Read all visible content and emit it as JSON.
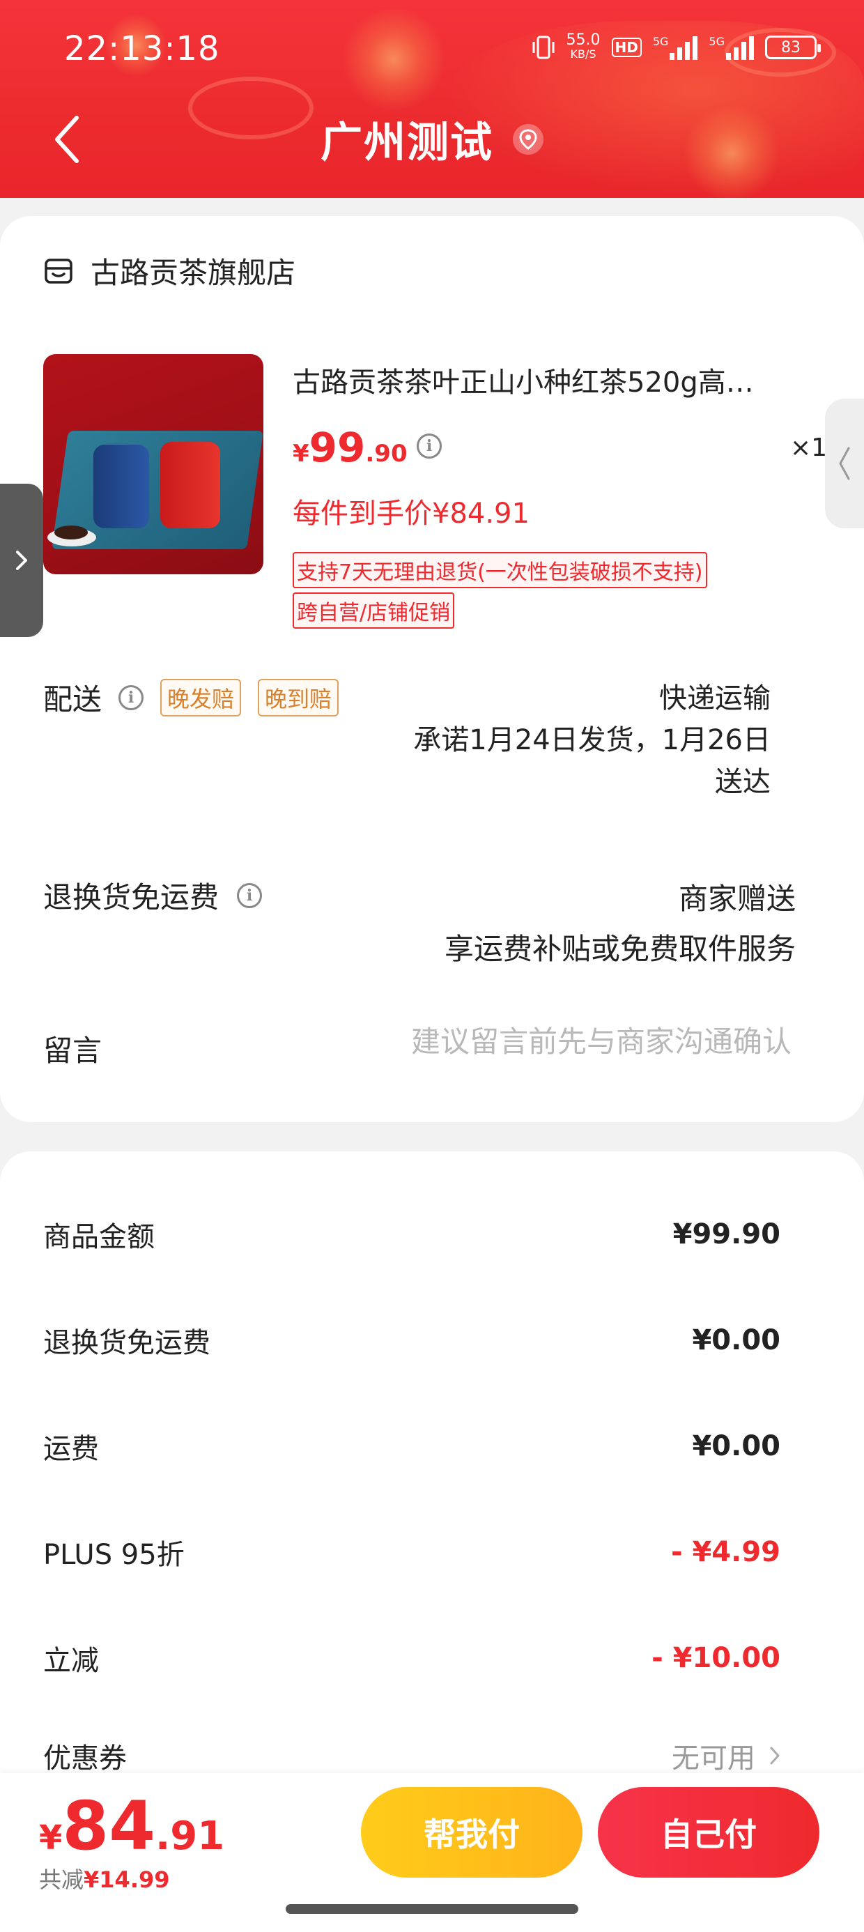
{
  "status_bar": {
    "time": "22:13:18",
    "speed_value": "55.0",
    "speed_unit": "KB/S",
    "hd": "HD",
    "net1": "5G",
    "net2": "5G",
    "battery": "83"
  },
  "header": {
    "title": "广州测试",
    "bg_color": "#ee2a2e"
  },
  "shop": {
    "name": "古路贡茶旗舰店"
  },
  "product": {
    "title": "古路贡茶茶叶正山小种红茶520g高…",
    "price_yen": "¥",
    "price_int": "99",
    "price_dec": ".90",
    "quantity": "×1",
    "unit_price": "每件到手价¥84.91",
    "tags": [
      "支持7天无理由退货(一次性包装破损不支持)",
      "跨自营/店铺促销"
    ]
  },
  "delivery": {
    "label": "配送",
    "badges": [
      "晚发赔",
      "晚到赔"
    ],
    "method": "快递运输",
    "promise_line1": "承诺1月24日发货，1月26日",
    "promise_line2": "送达"
  },
  "return_shipping": {
    "label": "退换货免运费",
    "value": "商家赠送",
    "desc": "享运费补贴或免费取件服务"
  },
  "message": {
    "label": "留言",
    "placeholder": "建议留言前先与商家沟通确认"
  },
  "summary": [
    {
      "label": "商品金额",
      "value": "¥99.90",
      "red": false
    },
    {
      "label": "退换货免运费",
      "value": "¥0.00",
      "red": false
    },
    {
      "label": "运费",
      "value": "¥0.00",
      "red": false
    },
    {
      "label": "PLUS 95折",
      "value": "- ¥4.99",
      "red": true
    },
    {
      "label": "立减",
      "value": "- ¥10.00",
      "red": true
    },
    {
      "label": "优惠券",
      "value": "无可用",
      "red": false
    }
  ],
  "bottom_bar": {
    "total_yen": "¥",
    "total_int": "84",
    "total_dec": ".91",
    "saved_label": "共减",
    "saved_value": "¥14.99",
    "help_pay": "帮我付",
    "self_pay": "自己付"
  },
  "colors": {
    "accent": "#ee2a2e",
    "yellow": "#ffbf1a",
    "badge": "#d8802c"
  }
}
